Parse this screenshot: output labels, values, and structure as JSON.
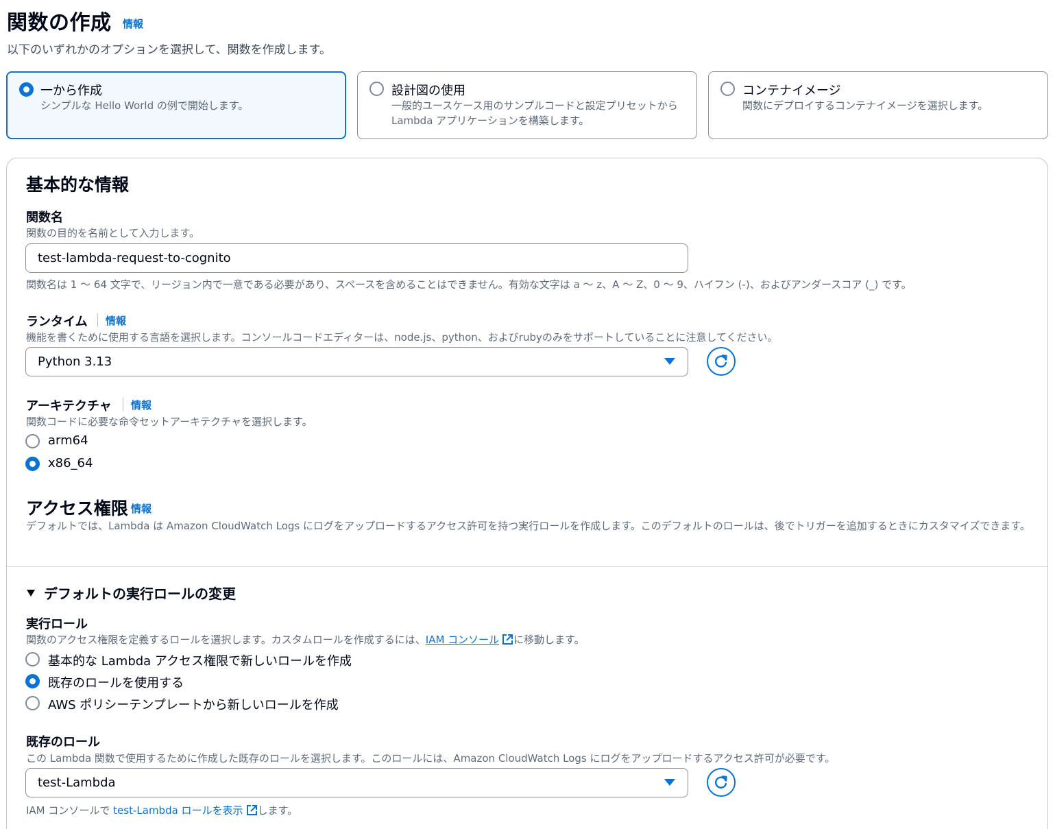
{
  "header": {
    "title": "関数の作成",
    "info": "情報",
    "description": "以下のいずれかのオプションを選択して、関数を作成します。"
  },
  "options": [
    {
      "title": "一から作成",
      "description": "シンプルな Hello World の例で開始します。",
      "selected": true
    },
    {
      "title": "設計図の使用",
      "description": "一般的ユースケース用のサンプルコードと設定プリセットから Lambda アプリケーションを構築します。",
      "selected": false
    },
    {
      "title": "コンテナイメージ",
      "description": "関数にデプロイするコンテナイメージを選択します。",
      "selected": false
    }
  ],
  "basic": {
    "heading": "基本的な情報",
    "function_name": {
      "label": "関数名",
      "description": "関数の目的を名前として入力します。",
      "value": "test-lambda-request-to-cognito",
      "constraint": "関数名は 1 〜 64 文字で、リージョン内で一意である必要があり、スペースを含めることはできません。有効な文字は a 〜 z、A 〜 Z、0 〜 9、ハイフン (-)、およびアンダースコア (_) です。"
    },
    "runtime": {
      "label": "ランタイム",
      "info": "情報",
      "description": "機能を書くために使用する言語を選択します。コンソールコードエディターは、node.js、python、およびrubyのみをサポートしていることに注意してください。",
      "value": "Python 3.13"
    },
    "architecture": {
      "label": "アーキテクチャ",
      "info": "情報",
      "description": "関数コードに必要な命令セットアーキテクチャを選択します。",
      "options": [
        "arm64",
        "x86_64"
      ],
      "selected": "x86_64"
    }
  },
  "access": {
    "heading": "アクセス権限",
    "info": "情報",
    "description": "デフォルトでは、Lambda は Amazon CloudWatch Logs にログをアップロードするアクセス許可を持つ実行ロールを作成します。このデフォルトのロールは、後でトリガーを追加するときにカスタマイズできます。"
  },
  "role": {
    "expander": "デフォルトの実行ロールの変更",
    "exec_label": "実行ロール",
    "exec_desc_prefix": "関数のアクセス権限を定義するロールを選択します。カスタムロールを作成するには、",
    "exec_desc_link": "IAM コンソール",
    "exec_desc_suffix": "に移動します。",
    "options": [
      "基本的な Lambda アクセス権限で新しいロールを作成",
      "既存のロールを使用する",
      "AWS ポリシーテンプレートから新しいロールを作成"
    ],
    "selected": "既存のロールを使用する",
    "existing_label": "既存のロール",
    "existing_desc": "この Lambda 関数で使用するために作成した既存のロールを選択します。このロールには、Amazon CloudWatch Logs にログをアップロードするアクセス許可が必要です。",
    "existing_value": "test-Lambda",
    "footer_prefix": "IAM コンソールで ",
    "footer_link": "test-Lambda ロールを表示",
    "footer_suffix": "します。"
  },
  "colors": {
    "accent": "#0972d3",
    "text": "#000716",
    "muted": "#5f6b7a",
    "border": "#8c8c94"
  },
  "icons": [
    "radio-icon",
    "refresh-icon",
    "caret-down-icon",
    "external-link-icon"
  ]
}
